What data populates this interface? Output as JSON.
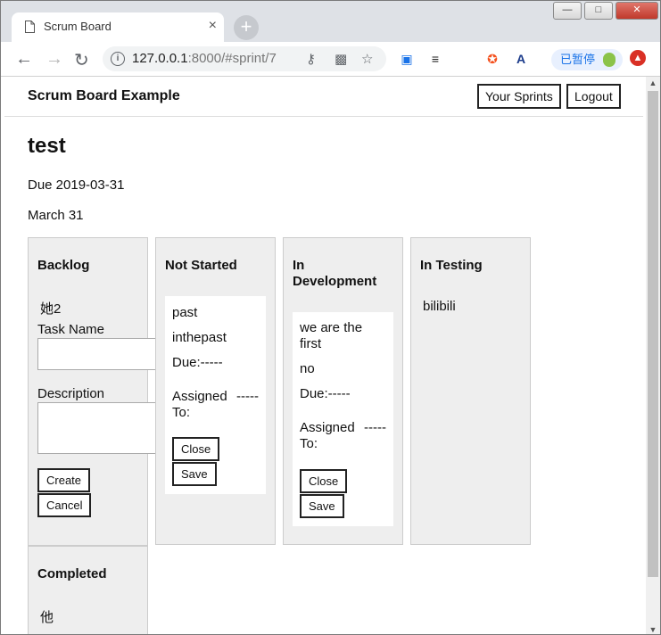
{
  "browser": {
    "tab_title": "Scrum Board",
    "tab_close": "×",
    "new_tab": "+",
    "url_host": "127.0.0.1",
    "url_rest": ":8000/#sprint/7",
    "pause_label": "已暂停",
    "window_buttons": [
      "—",
      "□",
      "✕"
    ]
  },
  "navbar": {
    "brand": "Scrum Board Example",
    "your_sprints": "Your Sprints",
    "logout": "Logout"
  },
  "sprint": {
    "name": "test",
    "due": "Due 2019-03-31",
    "end_date": "March 31"
  },
  "columns": {
    "backlog": {
      "title": "Backlog",
      "task": "她2",
      "task_name_label": "Task Name",
      "task_name_value": "",
      "description_label": "Description",
      "description_value": "",
      "create": "Create",
      "cancel": "Cancel"
    },
    "not_started": {
      "title": "Not Started",
      "card": {
        "name": "past",
        "description": "inthepast",
        "due": "Due:-----",
        "assigned_label": "Assigned To:",
        "assigned_value": "-----",
        "close": "Close",
        "save": "Save"
      }
    },
    "in_development": {
      "title": "In Development",
      "card": {
        "name": "we are the first",
        "description": "no",
        "due": "Due:-----",
        "assigned_label": "Assigned To:",
        "assigned_value": "-----",
        "close": "Close",
        "save": "Save"
      }
    },
    "in_testing": {
      "title": "In Testing",
      "task": "bilibili"
    },
    "completed": {
      "title": "Completed",
      "task": "他"
    }
  }
}
